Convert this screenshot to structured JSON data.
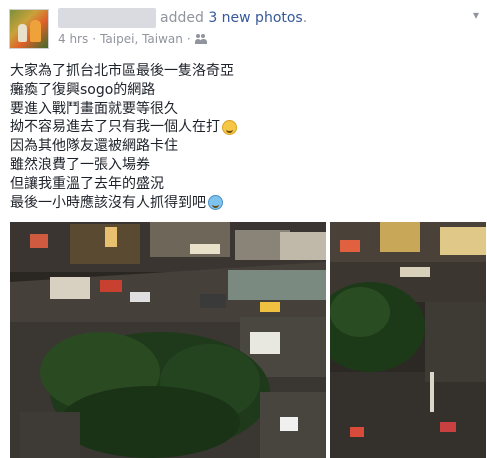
{
  "post": {
    "author_redacted": "",
    "action_text": "added",
    "action_link": "3 new photos",
    "action_end": ".",
    "time": "4 hrs",
    "location": "Taipei, Taiwan",
    "sep1": "·",
    "sep2": "·",
    "privacy_icon": "friends-icon",
    "chevron": "▾",
    "lines": [
      "大家為了抓台北市區最後一隻洛奇亞",
      "癱瘓了復興sogo的網路",
      "要進入戰鬥畫面就要等很久",
      "拗不容易進去了只有我一個人在打",
      "因為其他隊友還被網路卡住",
      "雖然浪費了一張入場券",
      "但讓我重溫了去年的盛況",
      "最後一小時應該沒有人抓得到吧"
    ],
    "emoji": {
      "line4": "grinning-sweat-emoji",
      "line8": "crying-emoji"
    },
    "photos": [
      "photo-crowd-street",
      "photo-crowd-trees"
    ]
  }
}
